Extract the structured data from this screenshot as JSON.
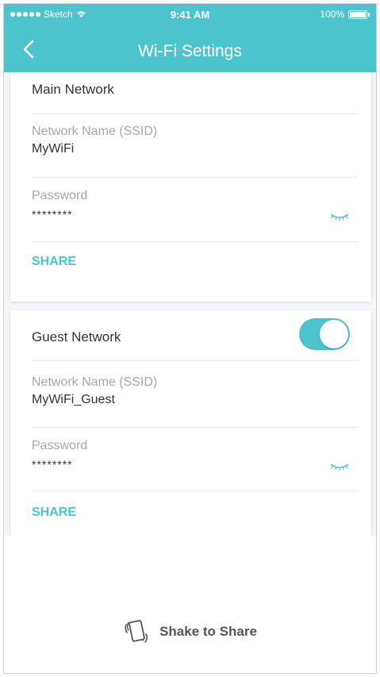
{
  "status_bar": {
    "carrier": "Sketch",
    "time": "9:41 AM",
    "battery": "100%"
  },
  "header": {
    "title": "Wi-Fi Settings"
  },
  "main_network": {
    "title": "Main Network",
    "ssid_label": "Network Name (SSID)",
    "ssid_value": "MyWiFi",
    "password_label": "Password",
    "password_value": "********",
    "share_label": "SHARE"
  },
  "guest_network": {
    "title": "Guest Network",
    "enabled": true,
    "ssid_label": "Network Name (SSID)",
    "ssid_value": "MyWiFi_Guest",
    "password_label": "Password",
    "password_value": "********",
    "share_label": "SHARE"
  },
  "shake": {
    "label": "Shake to Share"
  },
  "colors": {
    "accent": "#4dc3cc"
  }
}
